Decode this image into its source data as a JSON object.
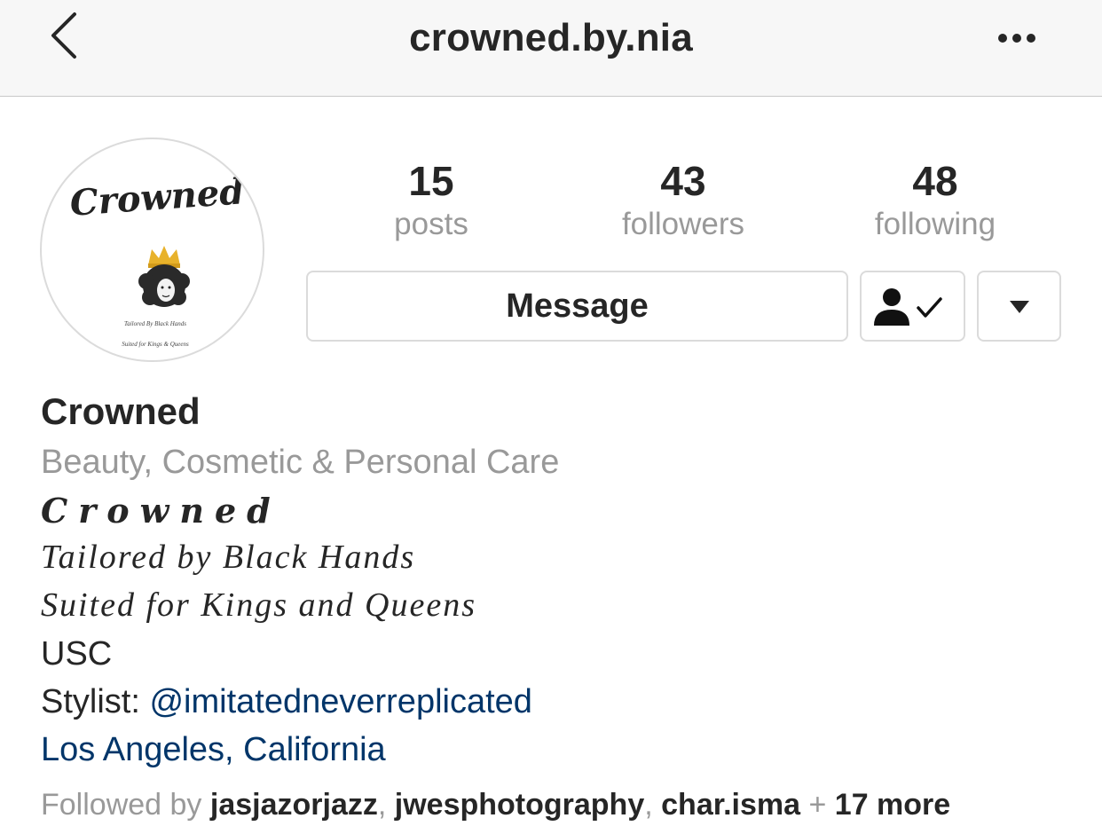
{
  "nav": {
    "title": "crowned.by.nia",
    "back_icon": "chevron-left-icon",
    "more_icon": "more-horizontal-icon"
  },
  "avatar": {
    "logo_text": "Crowned",
    "fine_print_1": "Tailored By Black Hands",
    "fine_print_2": "Suited for Kings & Queens"
  },
  "stats": [
    {
      "value": "15",
      "label": "posts"
    },
    {
      "value": "43",
      "label": "followers"
    },
    {
      "value": "48",
      "label": "following"
    }
  ],
  "actions": {
    "message_label": "Message",
    "following_icon": "person-check-icon",
    "dropdown_icon": "caret-down-icon"
  },
  "bio": {
    "name": "Crowned",
    "category": "Beauty, Cosmetic & Personal Care",
    "line1": "Crowned",
    "line2": "Tailored by Black Hands",
    "line3": "Suited for Kings and Queens",
    "line4": "USC",
    "stylist_prefix": "Stylist: ",
    "stylist_handle": "@imitatedneverreplicated",
    "location": "Los Angeles, California"
  },
  "followed_by": {
    "prefix": "Followed by ",
    "users": [
      "jasjazorjazz",
      "jwesphotography",
      "char.isma"
    ],
    "separator": ", ",
    "plus": " + ",
    "more": "17 more"
  },
  "colors": {
    "link": "#003569",
    "secondary_text": "#999999",
    "primary_text": "#262626",
    "crown": "#e8b22b"
  }
}
